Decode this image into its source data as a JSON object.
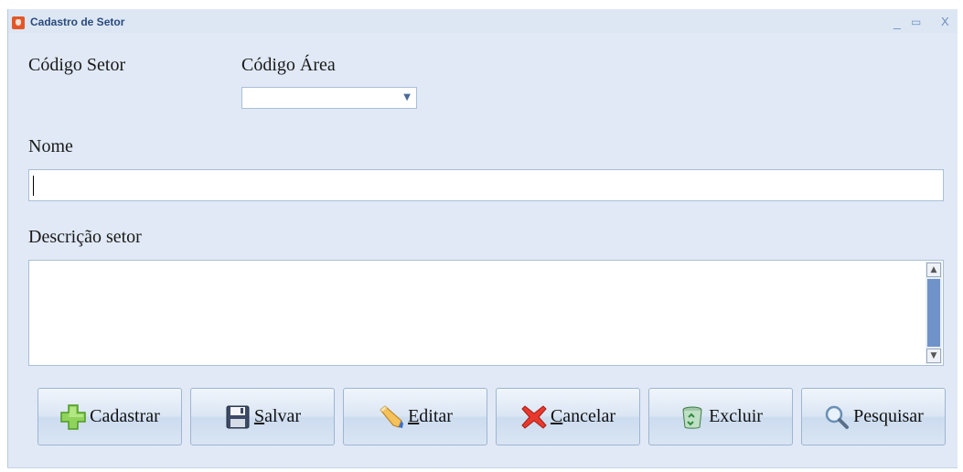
{
  "window": {
    "title": "Cadastro de Setor",
    "minimize": "_",
    "maximize": "▭",
    "close": "X"
  },
  "form": {
    "codigo_setor_label": "Código Setor",
    "codigo_area_label": "Código Área",
    "codigo_area_value": "",
    "nome_label": "Nome",
    "nome_value": "",
    "descricao_label": "Descrição setor",
    "descricao_value": ""
  },
  "buttons": [
    {
      "label": "Cadastrar",
      "icon": "plus-icon"
    },
    {
      "label": "Salvar",
      "accel": "S",
      "rest": "alvar",
      "icon": "floppy-disk-icon"
    },
    {
      "label": "Editar",
      "accel": "E",
      "rest": "ditar",
      "icon": "pencil-icon"
    },
    {
      "label": "Cancelar",
      "accel": "C",
      "rest": "ancelar",
      "icon": "red-x-icon"
    },
    {
      "label": "Excluir",
      "icon": "recycle-bin-icon"
    },
    {
      "label": "Pesquisar",
      "icon": "magnifier-icon"
    }
  ],
  "colors": {
    "window_bg": "#e0e9f5",
    "title_text": "#2a4a7c",
    "scroll_thumb": "#6f92c8"
  }
}
